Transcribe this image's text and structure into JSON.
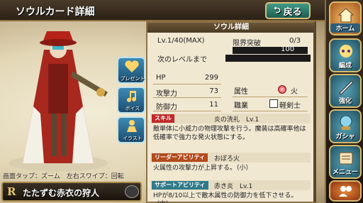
{
  "header": {
    "title": "ソウルカード詳細",
    "back_label": "戻る"
  },
  "character": {
    "hint": "画面タップ：ズーム　左右スワイプ：回転",
    "rank": "R",
    "name": "たたずむ赤衣の狩人"
  },
  "actions": [
    {
      "label": "プレゼント"
    },
    {
      "label": "ボイス"
    },
    {
      "label": "イラスト"
    }
  ],
  "panel": {
    "title": "ソウル詳細",
    "level": "Lv.1/40(MAX)",
    "limit_break_label": "限界突破",
    "limit_break_value": "0/3",
    "limit_break_num": "100",
    "next_level_label": "次のレベルまで",
    "exp_progress": 0,
    "hp_label": "HP",
    "hp_value": "299",
    "atk_label": "攻撃力",
    "atk_value": "73",
    "def_label": "防御力",
    "def_value": "11",
    "attribute_label": "属性",
    "attribute_value": "火",
    "job_label": "職業",
    "job_value": "軽剣士"
  },
  "skill": {
    "tag": "スキル",
    "name": "炎の洗礼　Lv.1",
    "desc": "敵単体に小威力の物理攻撃を行う。魔装は高確率他は低確率で強力な発火状態にする。"
  },
  "leader": {
    "tag": "リーダーアビリティ",
    "name": "おぼろ火",
    "desc": "火属性の攻撃力が上昇する。（小）"
  },
  "support": {
    "tag": "サポートアビリティ",
    "name": "赤き炎　Lv.1",
    "desc": "HPが8/10以上で敵木属性の防御力を低下させる。（中）"
  },
  "nav": [
    {
      "label": "ホーム"
    },
    {
      "label": "編成"
    },
    {
      "label": "強化"
    },
    {
      "label": "ガシャ"
    },
    {
      "label": "メニュー"
    }
  ],
  "colors": {
    "skill_tag": "#c0282a",
    "leader_tag": "#b34a1c",
    "support_tag": "#2f7a8a",
    "exp_fill": "#c98a24"
  }
}
